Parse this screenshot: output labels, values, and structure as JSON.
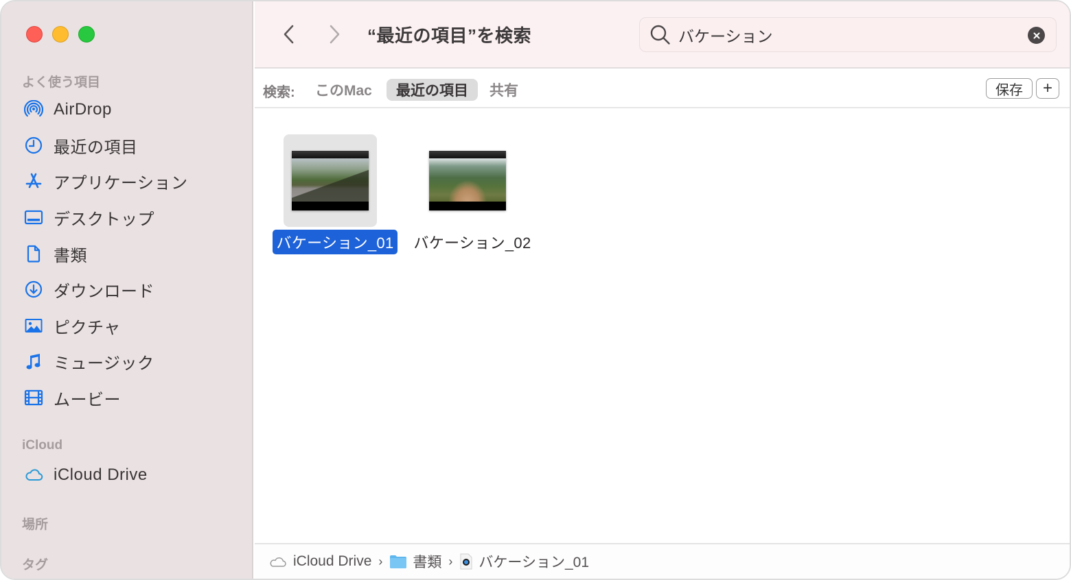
{
  "window": {
    "title": "“最近の項目”を検索",
    "traffic_lights": [
      "close",
      "minimize",
      "zoom"
    ]
  },
  "sidebar": {
    "sections": [
      {
        "title": "よく使う項目",
        "items": [
          {
            "label": "AirDrop",
            "icon": "airdrop-icon"
          },
          {
            "label": "最近の項目",
            "icon": "clock-icon"
          },
          {
            "label": "アプリケーション",
            "icon": "applications-icon"
          },
          {
            "label": "デスクトップ",
            "icon": "desktop-icon"
          },
          {
            "label": "書類",
            "icon": "document-icon"
          },
          {
            "label": "ダウンロード",
            "icon": "download-icon"
          },
          {
            "label": "ピクチャ",
            "icon": "pictures-icon"
          },
          {
            "label": "ミュージック",
            "icon": "music-icon"
          },
          {
            "label": "ムービー",
            "icon": "movies-icon"
          }
        ]
      },
      {
        "title": "iCloud",
        "items": [
          {
            "label": "iCloud Drive",
            "icon": "cloud-icon"
          }
        ]
      },
      {
        "title": "場所",
        "items": []
      },
      {
        "title": "タグ",
        "items": []
      }
    ]
  },
  "toolbar": {
    "back_icon": "chevron-left-icon",
    "forward_icon": "chevron-right-icon",
    "search": {
      "value": "バケーション",
      "placeholder": "検索"
    }
  },
  "scopebar": {
    "label": "検索:",
    "scopes": [
      {
        "label": "このMac",
        "active": false
      },
      {
        "label": "最近の項目",
        "active": true
      },
      {
        "label": "共有",
        "active": false
      }
    ],
    "save_label": "保存",
    "add_label": "+"
  },
  "files": [
    {
      "name": "バケーション_01",
      "selected": true
    },
    {
      "name": "バケーション_02",
      "selected": false
    }
  ],
  "pathbar": {
    "crumbs": [
      {
        "label": "iCloud Drive",
        "icon": "cloud-icon"
      },
      {
        "label": "書類",
        "icon": "folder-icon"
      },
      {
        "label": "バケーション_01",
        "icon": "quicktime-file-icon"
      }
    ],
    "separator": "›"
  },
  "colors": {
    "accent": "#1d62d8",
    "sidebar_icon": "#1a73e8",
    "sidebar_bg": "#e9e1e2",
    "toolbar_bg": "#fcf1f2"
  }
}
